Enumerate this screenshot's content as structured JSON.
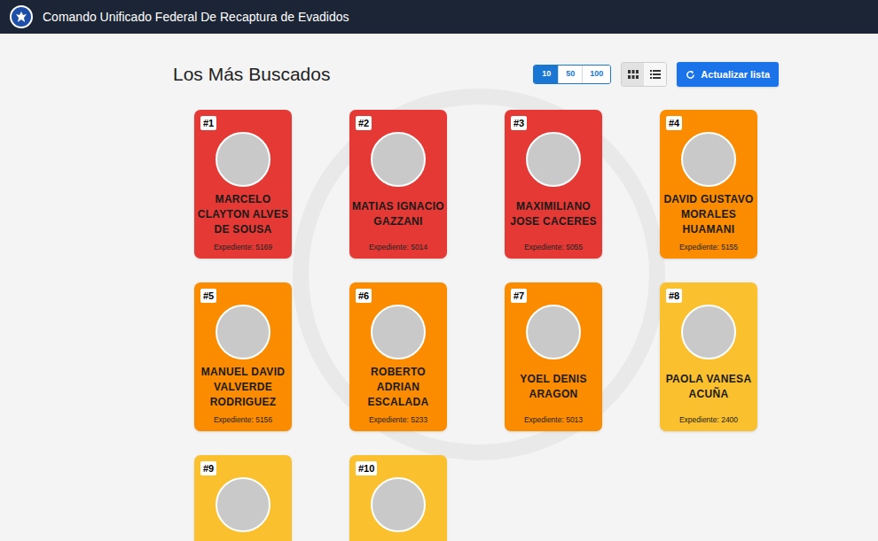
{
  "header": {
    "title": "Comando Unificado Federal De Recaptura de Evadidos"
  },
  "page": {
    "heading": "Los Más Buscados"
  },
  "page_size": [
    {
      "label": "10",
      "selected": true
    },
    {
      "label": "50",
      "selected": false
    },
    {
      "label": "100",
      "selected": false
    }
  ],
  "view_toggle": [
    {
      "kind": "grid",
      "selected": true
    },
    {
      "kind": "list",
      "selected": false
    }
  ],
  "refresh_button": {
    "label": "Actualizar lista"
  },
  "fugitives": [
    {
      "rank": "#1",
      "name": "MARCELO CLAYTON ALVES DE SOUSA",
      "file": "Expediente: 5169",
      "color": "#e53935"
    },
    {
      "rank": "#2",
      "name": "MATIAS IGNACIO GAZZANI",
      "file": "Expediente: 5014",
      "color": "#e53935"
    },
    {
      "rank": "#3",
      "name": "MAXIMILIANO JOSE CACERES",
      "file": "Expediente: 5055",
      "color": "#e53935"
    },
    {
      "rank": "#4",
      "name": "DAVID GUSTAVO MORALES HUAMANI",
      "file": "Expediente: 5155",
      "color": "#fb8c00"
    },
    {
      "rank": "#5",
      "name": "MANUEL DAVID VALVERDE RODRIGUEZ",
      "file": "Expediente: 5156",
      "color": "#fb8c00"
    },
    {
      "rank": "#6",
      "name": "ROBERTO ADRIAN ESCALADA",
      "file": "Expediente: 5233",
      "color": "#fb8c00"
    },
    {
      "rank": "#7",
      "name": "YOEL DENIS ARAGON",
      "file": "Expediente: 5013",
      "color": "#fb8c00"
    },
    {
      "rank": "#8",
      "name": "PAOLA VANESA ACUÑA",
      "file": "Expediente: 2400",
      "color": "#fbc02d"
    },
    {
      "rank": "#9",
      "color": "#fbc02d"
    },
    {
      "rank": "#10",
      "color": "#fbc02d"
    }
  ]
}
